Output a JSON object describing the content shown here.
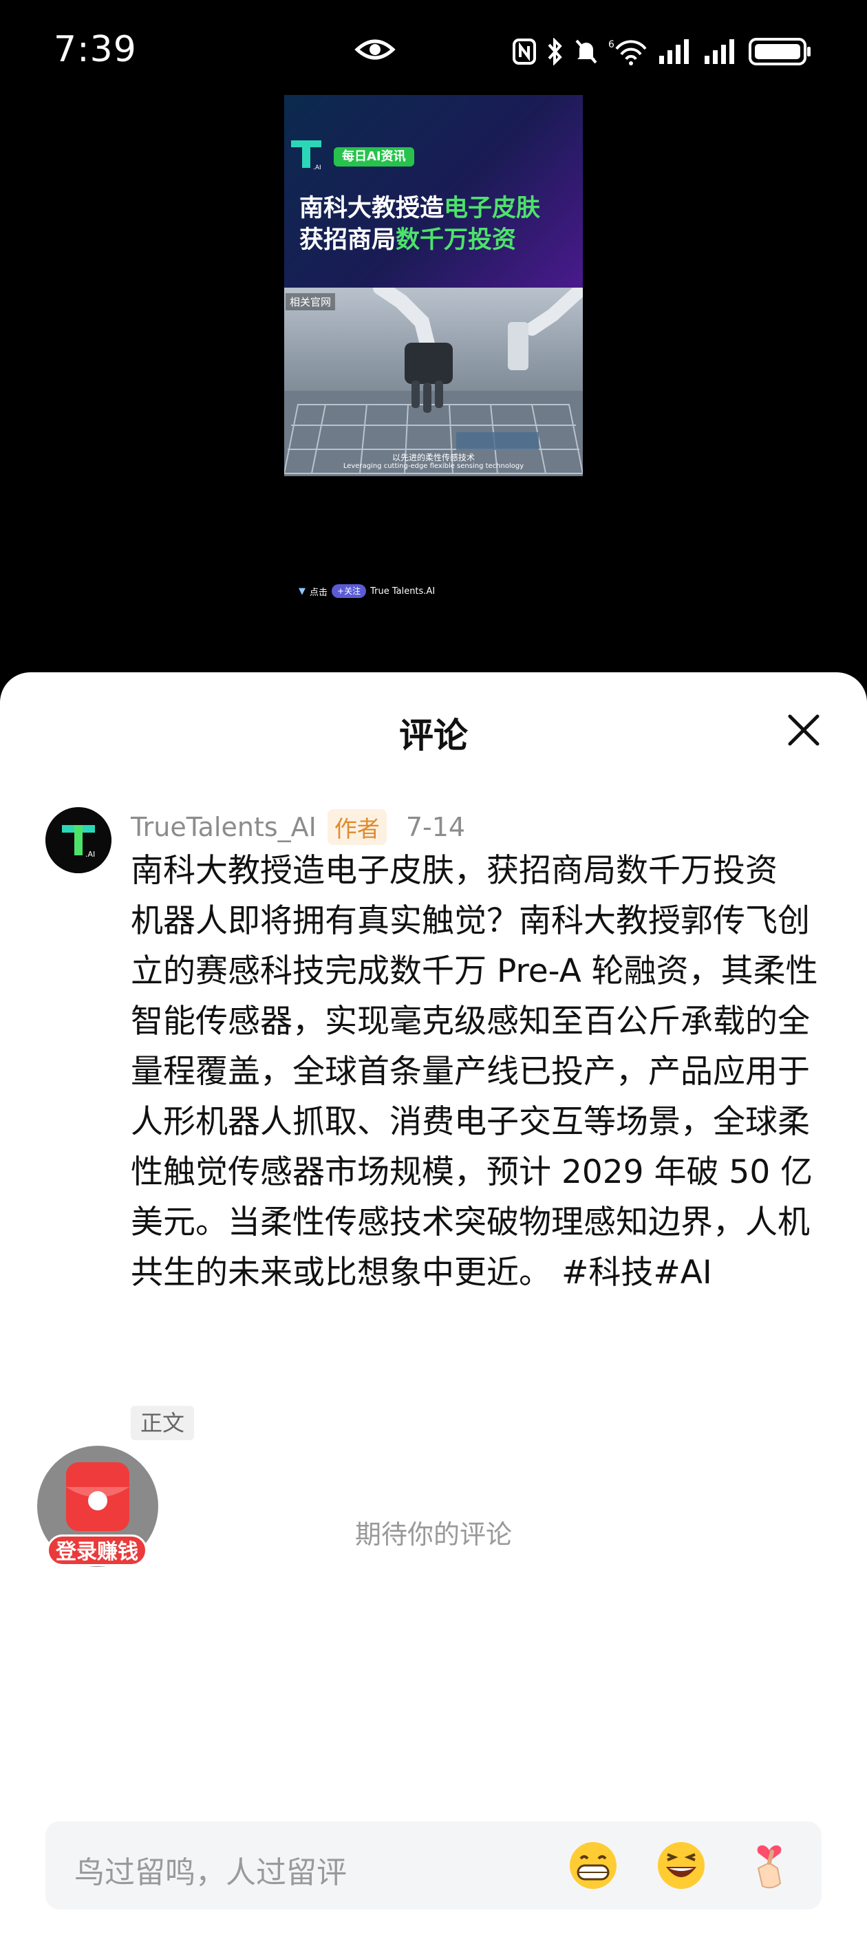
{
  "status": {
    "time": "7:39",
    "icons": [
      "eye-icon",
      "nfc-icon",
      "bluetooth-icon",
      "mute-icon",
      "wifi-6-icon",
      "signal-icon",
      "signal-icon",
      "battery-icon"
    ]
  },
  "video": {
    "badge": "每日AI资讯",
    "title_line1_a": "南科大教授造",
    "title_line1_b": "电子皮肤",
    "title_line2_a": "获招商局",
    "title_line2_b": "数千万投资",
    "source": "相关官网",
    "caption_cn": "以先进的柔性传感技术",
    "caption_en": "Leveraging cutting-edge flexible sensing technology",
    "follow_prefix": "点击",
    "follow_label": "+关注",
    "channel": "True Talents.AI"
  },
  "sheet": {
    "title": "评论",
    "comment": {
      "author": "TrueTalents_AI",
      "author_tag": "作者",
      "date": "7-14",
      "body": "南科大教授造电子皮肤，获招商局数千万投资 机器人即将拥有真实触觉？南科大教授郭传飞创立的赛感科技完成数千万 Pre-A 轮融资，其柔性智能传感器，实现毫克级感知至百公斤承载的全量程覆盖，全球首条量产线已投产，产品应用于人形机器人抓取、消费电子交互等场景，全球柔性触觉传感器市场规模，预计 2029 年破 50 亿美元。当柔性传感技术突破物理感知边界，人机共生的未来或比想象中更近。 #科技#AI",
      "tag": "正文"
    },
    "redpacket_label": "登录赚钱",
    "empty_hint": "期待你的评论",
    "input_placeholder": "鸟过留鸣，人过留评",
    "emojis": [
      "grinning-emoji",
      "laughing-emoji",
      "finger-heart-emoji"
    ]
  },
  "colors": {
    "accent_green": "#4de36a",
    "author_tag": "#e08a2c",
    "redpacket": "#ea3a3a"
  }
}
